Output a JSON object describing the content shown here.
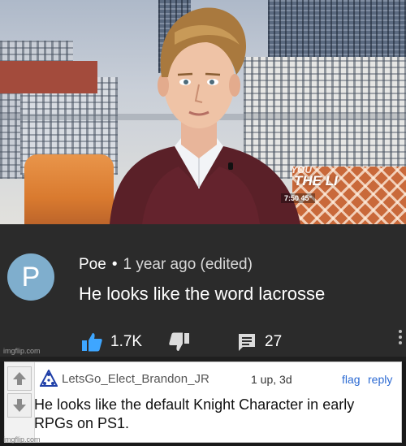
{
  "photo": {
    "tv_bug": {
      "top_text": "YOU",
      "main_text": "THE LI",
      "time_text": "7:50  45°"
    }
  },
  "youtube_comment": {
    "avatar_letter": "P",
    "avatar_color": "#7faecd",
    "author": "Poe",
    "separator": "•",
    "meta": "1 year ago (edited)",
    "text": "He looks like the word lacrosse",
    "like_icon": "thumbs-up-icon",
    "like_count": "1.7K",
    "dislike_icon": "thumbs-down-icon",
    "reply_icon": "comment-icon",
    "reply_count": "27",
    "more_icon": "more-vertical-icon",
    "accent_like": "#3ea6ff"
  },
  "watermarks": {
    "top": "imgflip.com",
    "bottom": "imgflip.com"
  },
  "reply_comment": {
    "upvote_icon": "arrow-up-icon",
    "downvote_icon": "arrow-down-icon",
    "badge_icon": "triangle-badge-icon",
    "username": "LetsGo_Elect_Brandon_JR",
    "points": "1 up, 3d",
    "flag_label": "flag",
    "reply_label": "reply",
    "text": "He looks like the default Knight Character in early RPGs on PS1.",
    "link_color": "#2d6bd3"
  }
}
